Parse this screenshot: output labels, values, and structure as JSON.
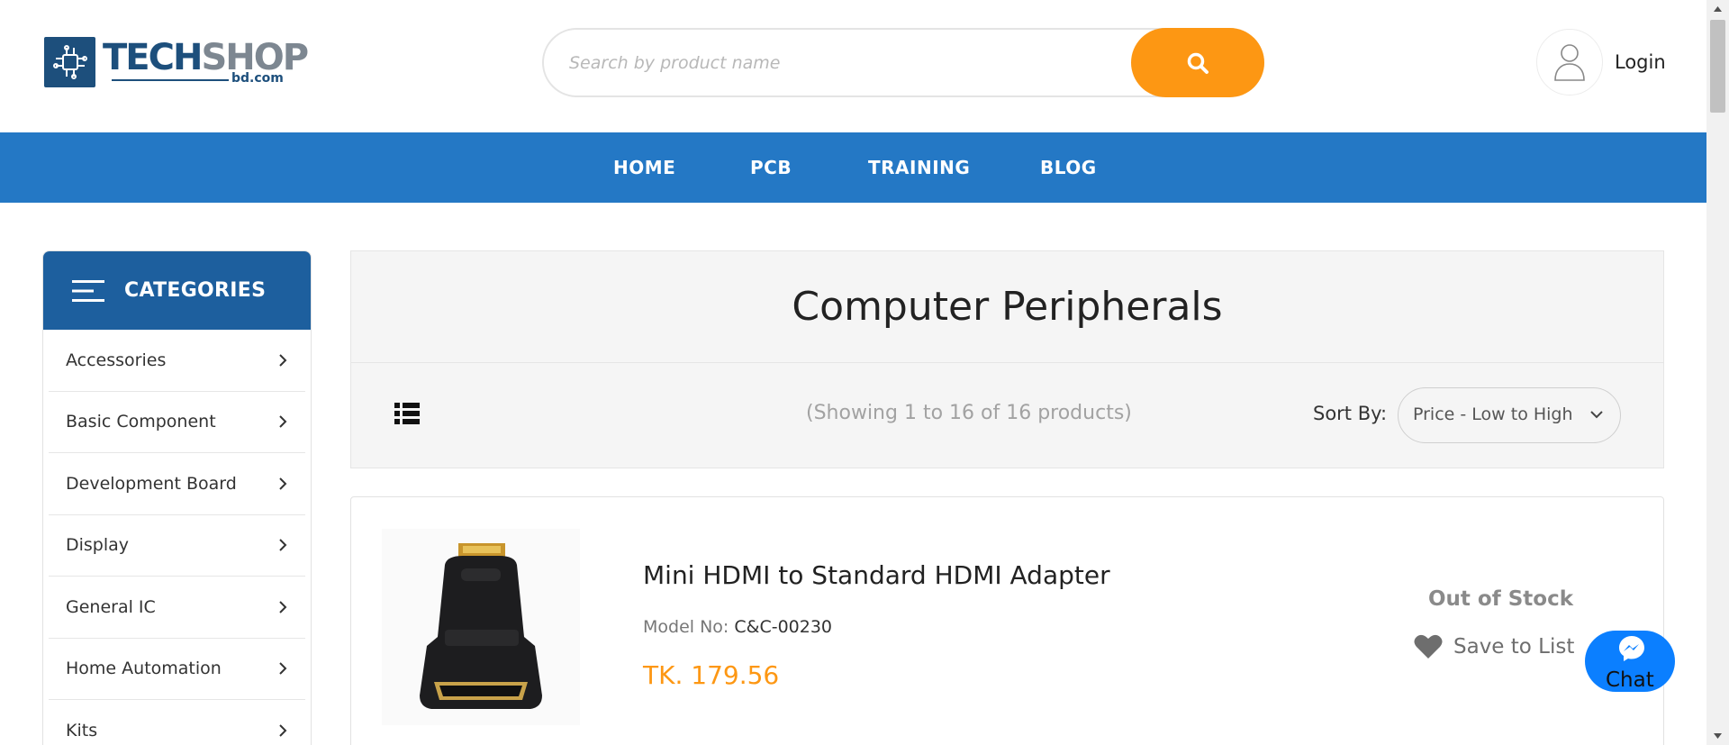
{
  "header": {
    "logo": {
      "name_part1": "TECH",
      "name_part2": "SHOP",
      "sub": "bd.com"
    },
    "search": {
      "placeholder": "Search by product name",
      "button_icon": "search-icon"
    },
    "login_label": "Login"
  },
  "nav": {
    "items": [
      "HOME",
      "PCB",
      "TRAINING",
      "BLOG"
    ]
  },
  "sidebar": {
    "title": "CATEGORIES",
    "items": [
      {
        "label": "Accessories"
      },
      {
        "label": "Basic Component"
      },
      {
        "label": "Development Board"
      },
      {
        "label": "Display"
      },
      {
        "label": "General IC"
      },
      {
        "label": "Home Automation"
      },
      {
        "label": "Kits"
      }
    ]
  },
  "main": {
    "title": "Computer Peripherals",
    "showing": "(Showing 1 to 16 of 16 products)",
    "sort_label": "Sort By:",
    "sort_value": "Price - Low to High"
  },
  "products": [
    {
      "name": "Mini HDMI to Standard HDMI Adapter",
      "model_label": "Model No:",
      "model_value": "C&C-00230",
      "price": "TK. 179.56",
      "stock": "Out of Stock",
      "save_label": "Save to List"
    }
  ],
  "chat": {
    "label": "Chat"
  },
  "colors": {
    "accent": "#fd9713",
    "nav": "#2478c5",
    "category_header": "#1d5f9e",
    "brand": "#1d4f7c",
    "messenger": "#0b7fff"
  }
}
